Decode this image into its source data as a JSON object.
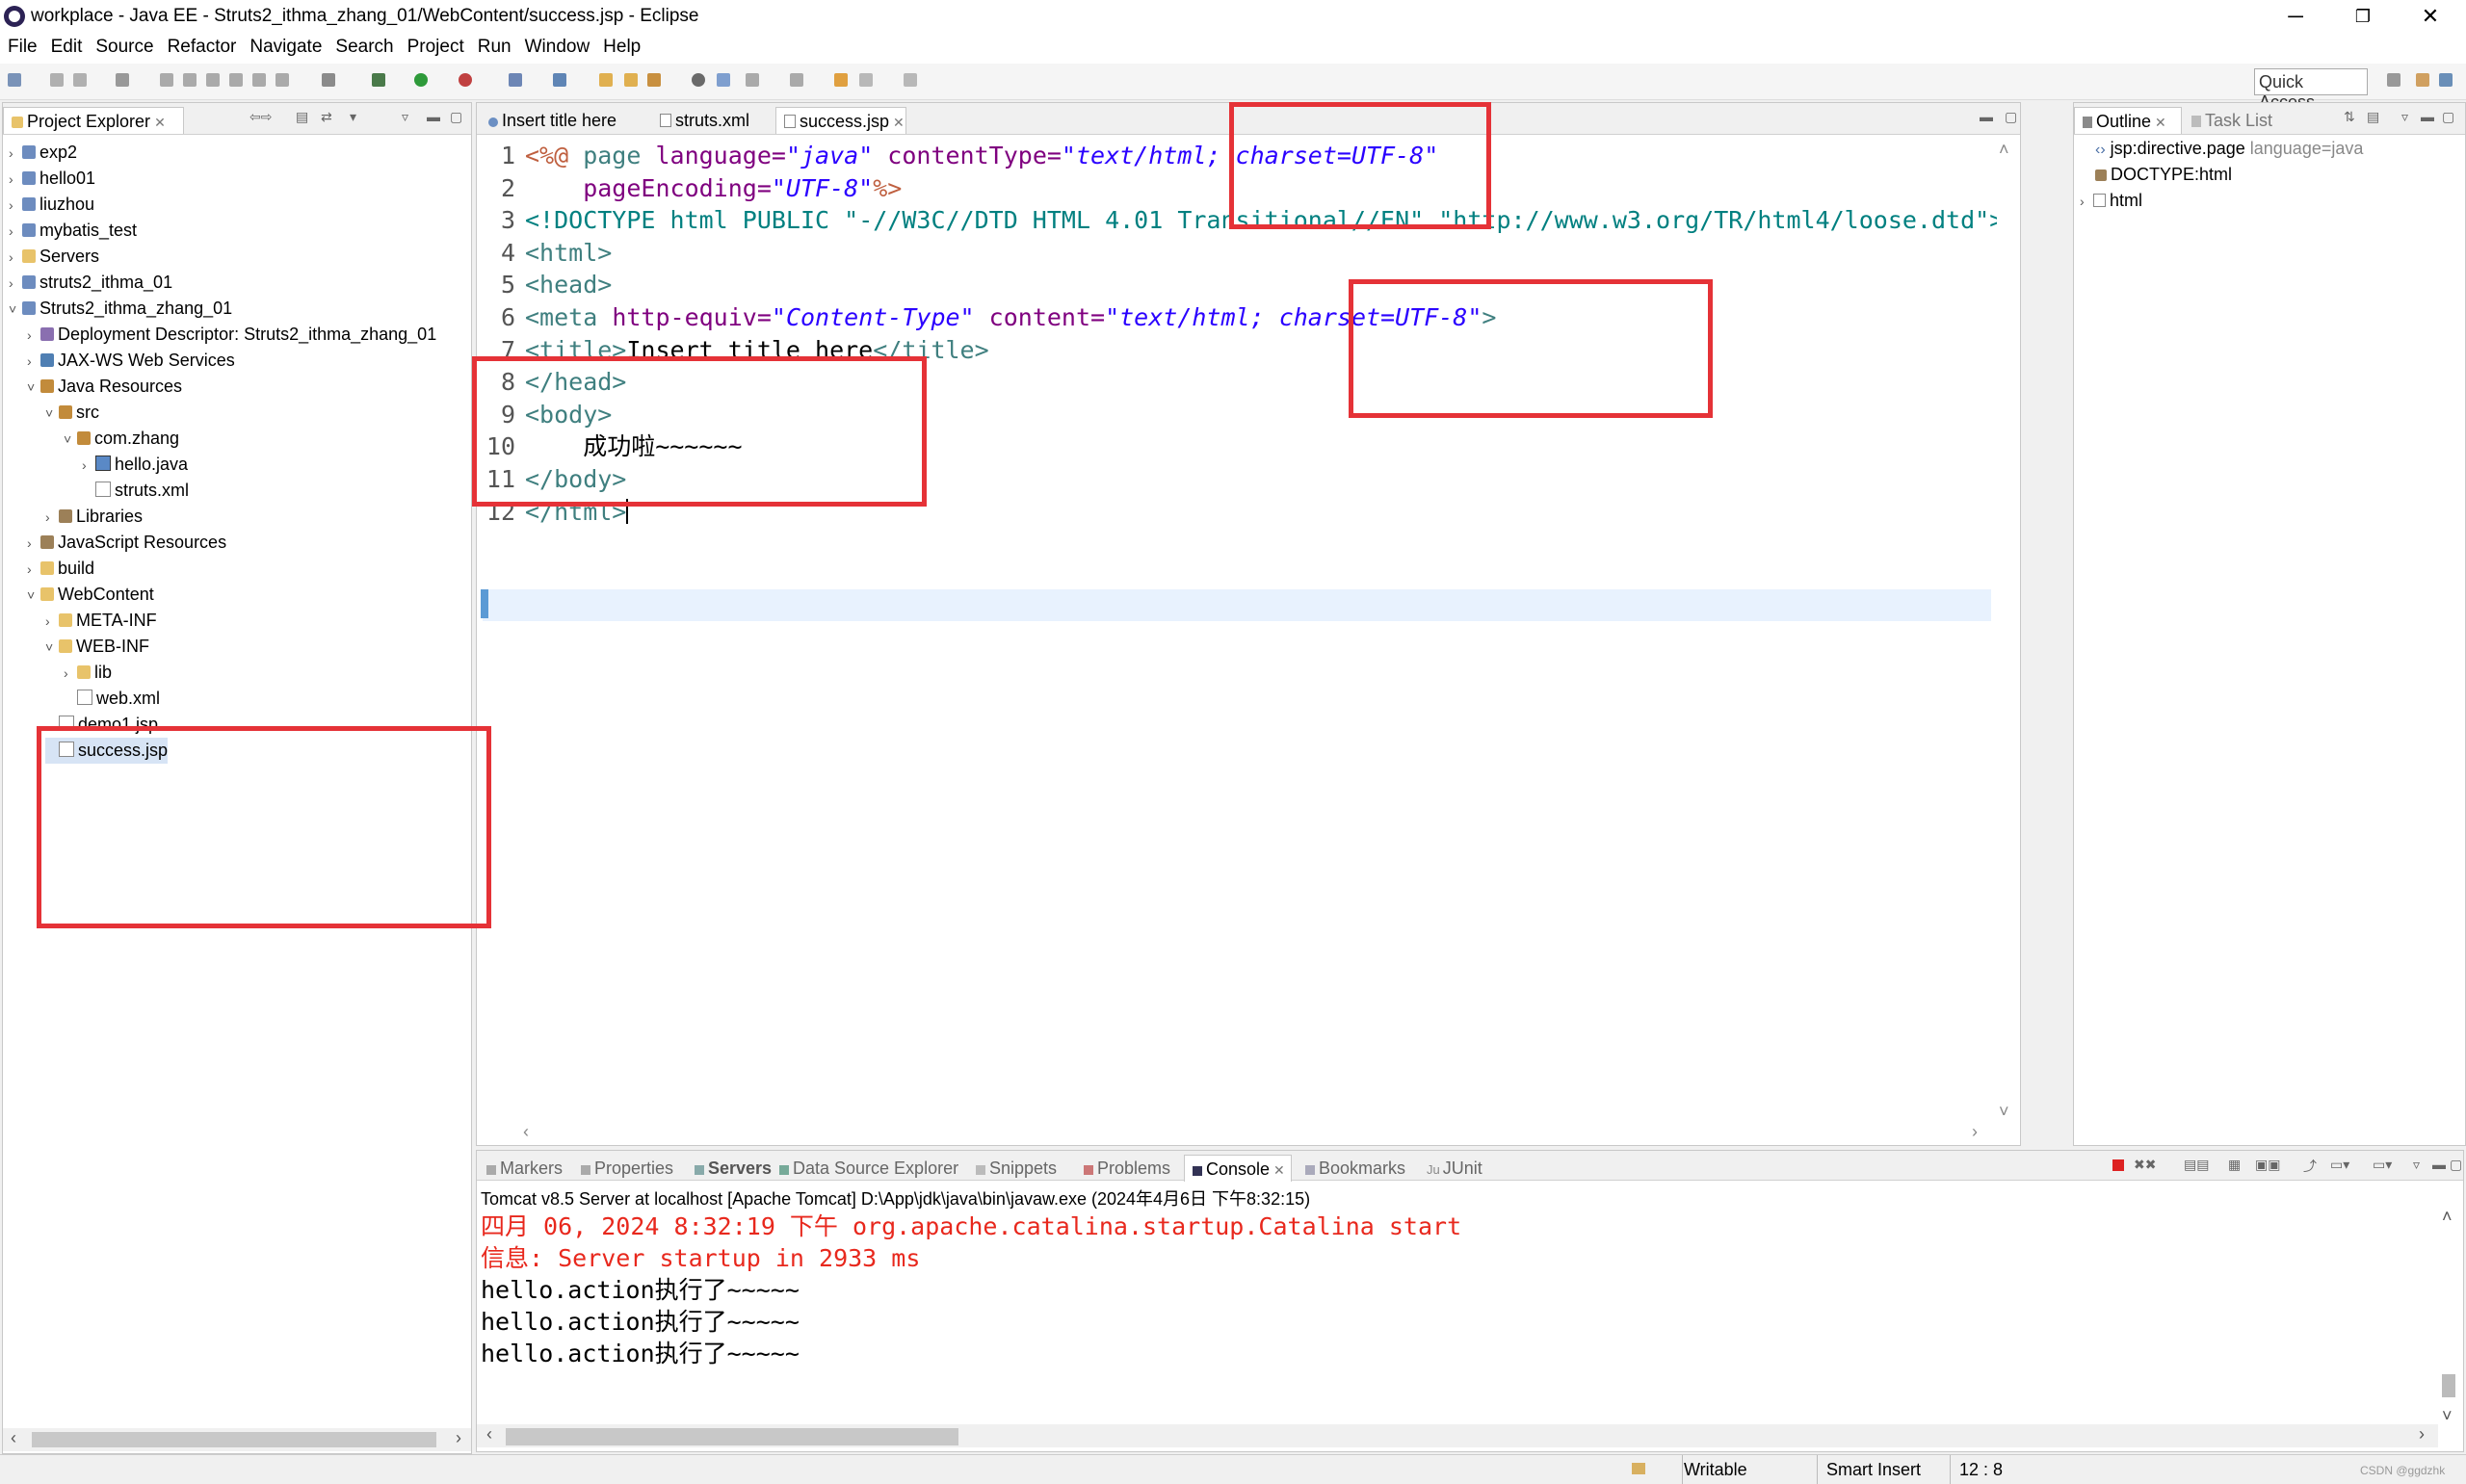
{
  "window": {
    "title": "workplace - Java EE - Struts2_ithma_zhang_01/WebContent/success.jsp - Eclipse",
    "minimize": "─",
    "restore": "❐",
    "close": "✕"
  },
  "menu": [
    "File",
    "Edit",
    "Source",
    "Refactor",
    "Navigate",
    "Search",
    "Project",
    "Run",
    "Window",
    "Help"
  ],
  "toolbar": {
    "quick_access": "Quick Access"
  },
  "project_explorer": {
    "tab_label": "Project Explorer",
    "items": [
      {
        "label": "exp2",
        "icon": "project-icon"
      },
      {
        "label": "hello01",
        "icon": "project-icon"
      },
      {
        "label": "liuzhou",
        "icon": "project-icon"
      },
      {
        "label": "mybatis_test",
        "icon": "project-icon"
      },
      {
        "label": "Servers",
        "icon": "folder-icon"
      },
      {
        "label": "struts2_ithma_01",
        "icon": "project-icon"
      },
      {
        "label": "Struts2_ithma_zhang_01",
        "icon": "project-icon"
      },
      {
        "label": "Deployment Descriptor: Struts2_ithma_zhang_01",
        "icon": "deployment-descriptor-icon"
      },
      {
        "label": "JAX-WS Web Services",
        "icon": "web-services-icon"
      },
      {
        "label": "Java Resources",
        "icon": "java-resources-icon"
      },
      {
        "label": "src",
        "icon": "source-folder-icon"
      },
      {
        "label": "com.zhang",
        "icon": "package-icon"
      },
      {
        "label": "hello.java",
        "icon": "java-file-icon"
      },
      {
        "label": "struts.xml",
        "icon": "xml-file-icon"
      },
      {
        "label": "Libraries",
        "icon": "library-icon"
      },
      {
        "label": "JavaScript Resources",
        "icon": "library-icon"
      },
      {
        "label": "build",
        "icon": "folder-icon"
      },
      {
        "label": "WebContent",
        "icon": "folder-icon"
      },
      {
        "label": "META-INF",
        "icon": "folder-icon"
      },
      {
        "label": "WEB-INF",
        "icon": "folder-icon"
      },
      {
        "label": "lib",
        "icon": "folder-icon"
      },
      {
        "label": "web.xml",
        "icon": "xml-file-icon"
      },
      {
        "label": "demo1.jsp",
        "icon": "jsp-file-icon"
      },
      {
        "label": "success.jsp",
        "icon": "jsp-file-icon"
      }
    ]
  },
  "editor": {
    "tabs": [
      {
        "label": "Insert title here"
      },
      {
        "label": "struts.xml"
      },
      {
        "label": "success.jsp"
      }
    ],
    "lines": [
      {
        "n": "1",
        "parts": [
          {
            "t": "<%@",
            "c": "jsp"
          },
          {
            "t": " page ",
            "c": "tag"
          },
          {
            "t": "language=",
            "c": "attr"
          },
          {
            "t": "\"java\"",
            "c": "val"
          },
          {
            "t": " contentType=",
            "c": "attr"
          },
          {
            "t": "\"text/html; charset=UTF-8\"",
            "c": "val"
          }
        ]
      },
      {
        "n": "2",
        "parts": [
          {
            "t": "    pageEncoding=",
            "c": "attr"
          },
          {
            "t": "\"UTF-8\"",
            "c": "val"
          },
          {
            "t": "%>",
            "c": "jsp"
          }
        ]
      },
      {
        "n": "3",
        "parts": [
          {
            "t": "<!DOCTYPE html PUBLIC ",
            "c": "dt"
          },
          {
            "t": "\"-//W3C//DTD HTML 4.01 Transitional//EN\" \"http://www.w3.org/TR/html4/loose.dtd\"",
            "c": "dt"
          },
          {
            "t": ">",
            "c": "dt"
          }
        ]
      },
      {
        "n": "4",
        "parts": [
          {
            "t": "<html>",
            "c": "tag"
          }
        ]
      },
      {
        "n": "5",
        "parts": [
          {
            "t": "<head>",
            "c": "tag"
          }
        ]
      },
      {
        "n": "6",
        "parts": [
          {
            "t": "<meta ",
            "c": "tag"
          },
          {
            "t": "http-equiv=",
            "c": "attr"
          },
          {
            "t": "\"Content-Type\"",
            "c": "val"
          },
          {
            "t": " content=",
            "c": "attr"
          },
          {
            "t": "\"text/html; charset=UTF-8\"",
            "c": "val"
          },
          {
            "t": ">",
            "c": "tag"
          }
        ]
      },
      {
        "n": "7",
        "parts": [
          {
            "t": "<title>",
            "c": "tag"
          },
          {
            "t": "Insert title here",
            "c": "txt"
          },
          {
            "t": "</title>",
            "c": "tag"
          }
        ]
      },
      {
        "n": "8",
        "parts": [
          {
            "t": "</head>",
            "c": "tag"
          }
        ]
      },
      {
        "n": "9",
        "parts": [
          {
            "t": "<body>",
            "c": "tag"
          }
        ]
      },
      {
        "n": "10",
        "parts": [
          {
            "t": "    成功啦~~~~~~",
            "c": "txt"
          }
        ]
      },
      {
        "n": "11",
        "parts": [
          {
            "t": "</body>",
            "c": "tag"
          }
        ]
      },
      {
        "n": "12",
        "parts": [
          {
            "t": "</html>",
            "c": "tag"
          }
        ]
      }
    ]
  },
  "outline": {
    "tab_label": "Outline",
    "task_tab": "Task List",
    "items": [
      {
        "label": "jsp:directive.page",
        "suffix": " language=java"
      },
      {
        "label": "DOCTYPE:html",
        "suffix": ""
      },
      {
        "label": "html",
        "suffix": ""
      }
    ]
  },
  "bottom": {
    "tabs": [
      "Markers",
      "Properties",
      "Servers",
      "Data Source Explorer",
      "Snippets",
      "Problems",
      "Console",
      "Bookmarks",
      "JUnit"
    ],
    "console_header": "Tomcat v8.5 Server at localhost [Apache Tomcat] D:\\App\\jdk\\java\\bin\\javaw.exe (2024年4月6日 下午8:32:15)",
    "lines": [
      {
        "text": "四月 06, 2024 8:32:19 下午 org.apache.catalina.startup.Catalina start",
        "color": "#e8281d"
      },
      {
        "text": "信息: Server startup in 2933 ms",
        "color": "#e8281d"
      },
      {
        "text": "hello.action执行了~~~~~",
        "color": "#000000"
      },
      {
        "text": "hello.action执行了~~~~~",
        "color": "#000000"
      },
      {
        "text": "hello.action执行了~~~~~",
        "color": "#000000"
      }
    ]
  },
  "status": {
    "writable": "Writable",
    "insert_mode": "Smart Insert",
    "position": "12 : 8",
    "watermark": "CSDN @ggdzhk"
  },
  "colors": {
    "annotation_red": "#e53237",
    "console_error": "#e8281d",
    "tag": "#3f7f7f",
    "attr": "#7f007f",
    "value": "#2a00ff"
  }
}
